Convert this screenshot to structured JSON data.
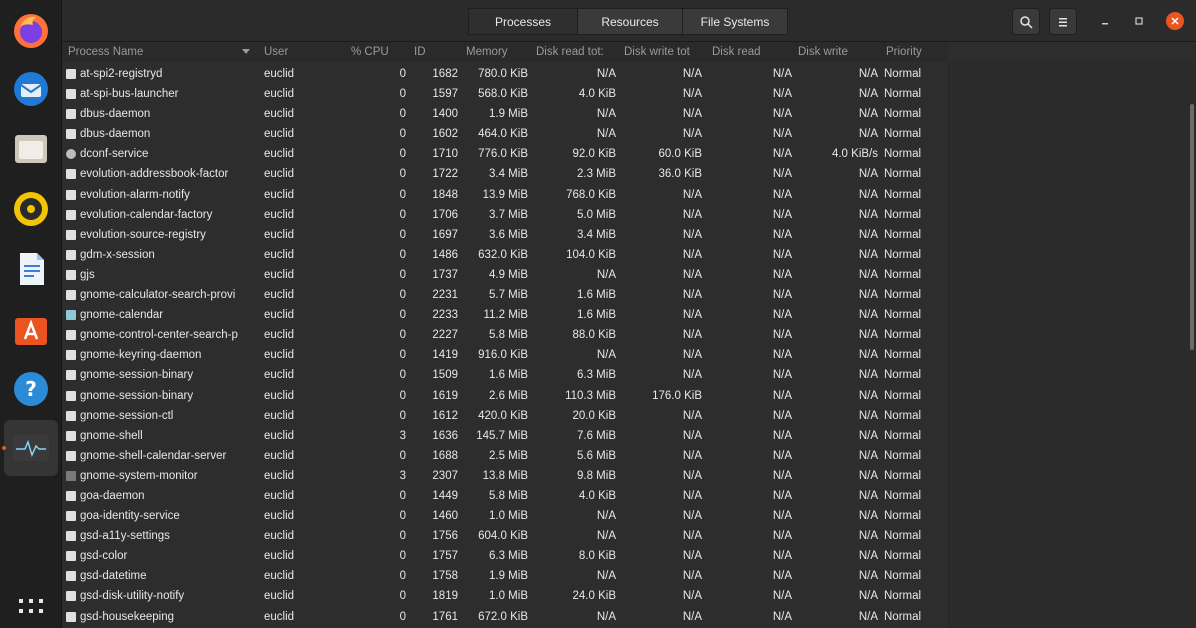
{
  "dock": {
    "items": [
      {
        "name": "firefox-icon"
      },
      {
        "name": "thunderbird-icon"
      },
      {
        "name": "files-icon"
      },
      {
        "name": "rhythmbox-icon"
      },
      {
        "name": "libreoffice-writer-icon"
      },
      {
        "name": "software-center-icon"
      },
      {
        "name": "help-icon"
      },
      {
        "name": "system-monitor-icon"
      },
      {
        "name": "show-apps-icon"
      }
    ]
  },
  "header": {
    "tabs": [
      {
        "label": "Processes"
      },
      {
        "label": "Resources"
      },
      {
        "label": "File Systems"
      }
    ]
  },
  "table": {
    "columns": {
      "name": "Process Name",
      "user": "User",
      "cpu": "% CPU",
      "id": "ID",
      "memory": "Memory",
      "disk_read_total": "Disk read tot:",
      "disk_write_total": "Disk write tot",
      "disk_read": "Disk read",
      "disk_write": "Disk write",
      "priority": "Priority"
    },
    "rows": [
      {
        "name": "at-spi2-registryd",
        "user": "euclid",
        "cpu": "0",
        "id": "1682",
        "memory": "780.0 KiB",
        "drt": "N/A",
        "dwt": "N/A",
        "dr": "N/A",
        "dw": "N/A",
        "priority": "Normal"
      },
      {
        "name": "at-spi-bus-launcher",
        "user": "euclid",
        "cpu": "0",
        "id": "1597",
        "memory": "568.0 KiB",
        "drt": "4.0 KiB",
        "dwt": "N/A",
        "dr": "N/A",
        "dw": "N/A",
        "priority": "Normal"
      },
      {
        "name": "dbus-daemon",
        "user": "euclid",
        "cpu": "0",
        "id": "1400",
        "memory": "1.9 MiB",
        "drt": "N/A",
        "dwt": "N/A",
        "dr": "N/A",
        "dw": "N/A",
        "priority": "Normal"
      },
      {
        "name": "dbus-daemon",
        "user": "euclid",
        "cpu": "0",
        "id": "1602",
        "memory": "464.0 KiB",
        "drt": "N/A",
        "dwt": "N/A",
        "dr": "N/A",
        "dw": "N/A",
        "priority": "Normal"
      },
      {
        "name": "dconf-service",
        "user": "euclid",
        "cpu": "0",
        "id": "1710",
        "memory": "776.0 KiB",
        "drt": "92.0 KiB",
        "dwt": "60.0 KiB",
        "dr": "N/A",
        "dw": "4.0 KiB/s",
        "priority": "Normal"
      },
      {
        "name": "evolution-addressbook-factor",
        "user": "euclid",
        "cpu": "0",
        "id": "1722",
        "memory": "3.4 MiB",
        "drt": "2.3 MiB",
        "dwt": "36.0 KiB",
        "dr": "N/A",
        "dw": "N/A",
        "priority": "Normal"
      },
      {
        "name": "evolution-alarm-notify",
        "user": "euclid",
        "cpu": "0",
        "id": "1848",
        "memory": "13.9 MiB",
        "drt": "768.0 KiB",
        "dwt": "N/A",
        "dr": "N/A",
        "dw": "N/A",
        "priority": "Normal"
      },
      {
        "name": "evolution-calendar-factory",
        "user": "euclid",
        "cpu": "0",
        "id": "1706",
        "memory": "3.7 MiB",
        "drt": "5.0 MiB",
        "dwt": "N/A",
        "dr": "N/A",
        "dw": "N/A",
        "priority": "Normal"
      },
      {
        "name": "evolution-source-registry",
        "user": "euclid",
        "cpu": "0",
        "id": "1697",
        "memory": "3.6 MiB",
        "drt": "3.4 MiB",
        "dwt": "N/A",
        "dr": "N/A",
        "dw": "N/A",
        "priority": "Normal"
      },
      {
        "name": "gdm-x-session",
        "user": "euclid",
        "cpu": "0",
        "id": "1486",
        "memory": "632.0 KiB",
        "drt": "104.0 KiB",
        "dwt": "N/A",
        "dr": "N/A",
        "dw": "N/A",
        "priority": "Normal"
      },
      {
        "name": "gjs",
        "user": "euclid",
        "cpu": "0",
        "id": "1737",
        "memory": "4.9 MiB",
        "drt": "N/A",
        "dwt": "N/A",
        "dr": "N/A",
        "dw": "N/A",
        "priority": "Normal"
      },
      {
        "name": "gnome-calculator-search-provi",
        "user": "euclid",
        "cpu": "0",
        "id": "2231",
        "memory": "5.7 MiB",
        "drt": "1.6 MiB",
        "dwt": "N/A",
        "dr": "N/A",
        "dw": "N/A",
        "priority": "Normal"
      },
      {
        "name": "gnome-calendar",
        "user": "euclid",
        "cpu": "0",
        "id": "2233",
        "memory": "11.2 MiB",
        "drt": "1.6 MiB",
        "dwt": "N/A",
        "dr": "N/A",
        "dw": "N/A",
        "priority": "Normal"
      },
      {
        "name": "gnome-control-center-search-p",
        "user": "euclid",
        "cpu": "0",
        "id": "2227",
        "memory": "5.8 MiB",
        "drt": "88.0 KiB",
        "dwt": "N/A",
        "dr": "N/A",
        "dw": "N/A",
        "priority": "Normal"
      },
      {
        "name": "gnome-keyring-daemon",
        "user": "euclid",
        "cpu": "0",
        "id": "1419",
        "memory": "916.0 KiB",
        "drt": "N/A",
        "dwt": "N/A",
        "dr": "N/A",
        "dw": "N/A",
        "priority": "Normal"
      },
      {
        "name": "gnome-session-binary",
        "user": "euclid",
        "cpu": "0",
        "id": "1509",
        "memory": "1.6 MiB",
        "drt": "6.3 MiB",
        "dwt": "N/A",
        "dr": "N/A",
        "dw": "N/A",
        "priority": "Normal"
      },
      {
        "name": "gnome-session-binary",
        "user": "euclid",
        "cpu": "0",
        "id": "1619",
        "memory": "2.6 MiB",
        "drt": "110.3 MiB",
        "dwt": "176.0 KiB",
        "dr": "N/A",
        "dw": "N/A",
        "priority": "Normal"
      },
      {
        "name": "gnome-session-ctl",
        "user": "euclid",
        "cpu": "0",
        "id": "1612",
        "memory": "420.0 KiB",
        "drt": "20.0 KiB",
        "dwt": "N/A",
        "dr": "N/A",
        "dw": "N/A",
        "priority": "Normal"
      },
      {
        "name": "gnome-shell",
        "user": "euclid",
        "cpu": "3",
        "id": "1636",
        "memory": "145.7 MiB",
        "drt": "7.6 MiB",
        "dwt": "N/A",
        "dr": "N/A",
        "dw": "N/A",
        "priority": "Normal"
      },
      {
        "name": "gnome-shell-calendar-server",
        "user": "euclid",
        "cpu": "0",
        "id": "1688",
        "memory": "2.5 MiB",
        "drt": "5.6 MiB",
        "dwt": "N/A",
        "dr": "N/A",
        "dw": "N/A",
        "priority": "Normal"
      },
      {
        "name": "gnome-system-monitor",
        "user": "euclid",
        "cpu": "3",
        "id": "2307",
        "memory": "13.8 MiB",
        "drt": "9.8 MiB",
        "dwt": "N/A",
        "dr": "N/A",
        "dw": "N/A",
        "priority": "Normal"
      },
      {
        "name": "goa-daemon",
        "user": "euclid",
        "cpu": "0",
        "id": "1449",
        "memory": "5.8 MiB",
        "drt": "4.0 KiB",
        "dwt": "N/A",
        "dr": "N/A",
        "dw": "N/A",
        "priority": "Normal"
      },
      {
        "name": "goa-identity-service",
        "user": "euclid",
        "cpu": "0",
        "id": "1460",
        "memory": "1.0 MiB",
        "drt": "N/A",
        "dwt": "N/A",
        "dr": "N/A",
        "dw": "N/A",
        "priority": "Normal"
      },
      {
        "name": "gsd-a11y-settings",
        "user": "euclid",
        "cpu": "0",
        "id": "1756",
        "memory": "604.0 KiB",
        "drt": "N/A",
        "dwt": "N/A",
        "dr": "N/A",
        "dw": "N/A",
        "priority": "Normal"
      },
      {
        "name": "gsd-color",
        "user": "euclid",
        "cpu": "0",
        "id": "1757",
        "memory": "6.3 MiB",
        "drt": "8.0 KiB",
        "dwt": "N/A",
        "dr": "N/A",
        "dw": "N/A",
        "priority": "Normal"
      },
      {
        "name": "gsd-datetime",
        "user": "euclid",
        "cpu": "0",
        "id": "1758",
        "memory": "1.9 MiB",
        "drt": "N/A",
        "dwt": "N/A",
        "dr": "N/A",
        "dw": "N/A",
        "priority": "Normal"
      },
      {
        "name": "gsd-disk-utility-notify",
        "user": "euclid",
        "cpu": "0",
        "id": "1819",
        "memory": "1.0 MiB",
        "drt": "24.0 KiB",
        "dwt": "N/A",
        "dr": "N/A",
        "dw": "N/A",
        "priority": "Normal"
      },
      {
        "name": "gsd-housekeeping",
        "user": "euclid",
        "cpu": "0",
        "id": "1761",
        "memory": "672.0 KiB",
        "drt": "N/A",
        "dwt": "N/A",
        "dr": "N/A",
        "dw": "N/A",
        "priority": "Normal"
      }
    ]
  }
}
